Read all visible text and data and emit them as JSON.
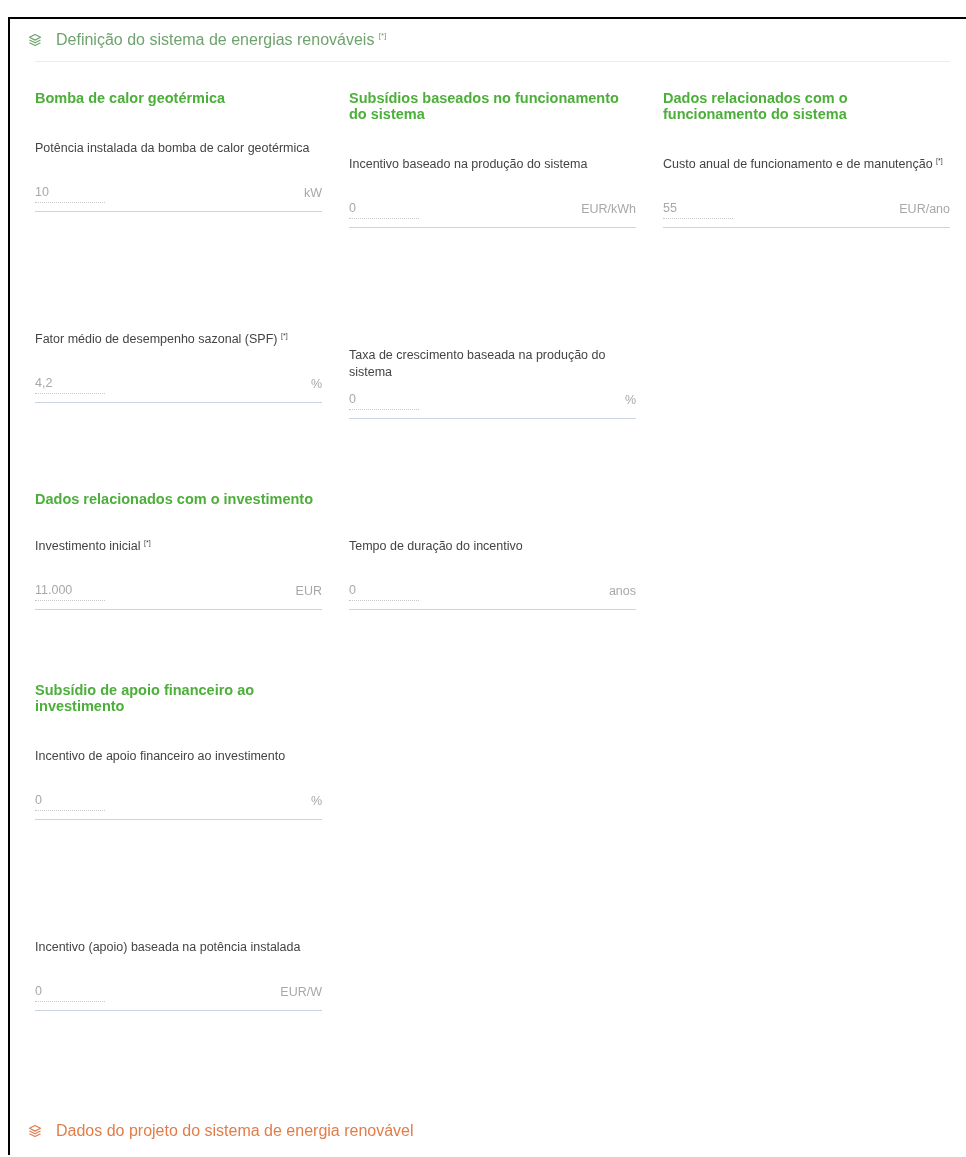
{
  "sections": [
    {
      "title": "Definição do sistema de energias renováveis $^{[*]}$",
      "expanded": true,
      "groups": [
        {
          "columns": [
            {
              "heading": "Bomba de calor geotérmica",
              "fields": [
                {
                  "label": "Potência instalada da bomba de calor geotérmica",
                  "value": "10",
                  "unit": "kW"
                },
                {
                  "label": "Fator médio de desempenho sazonal (SPF) $^{[*]}$",
                  "value": "4,2",
                  "unit": "%"
                }
              ]
            },
            {
              "heading": "Subsídios baseados no funcionamento do sistema",
              "fields": [
                {
                  "label": "Incentivo baseado na produção do sistema",
                  "value": "0",
                  "unit": "EUR/kWh"
                },
                {
                  "label": "Taxa de crescimento baseada na produção do sistema",
                  "value": "0",
                  "unit": "%"
                }
              ]
            },
            {
              "heading": "Dados relacionados com o funcionamento do sistema",
              "fields": [
                {
                  "label": "Custo anual de funcionamento e de manutenção $^{[*]}$",
                  "value": "55",
                  "unit": "EUR/ano"
                }
              ]
            }
          ]
        },
        {
          "heading": "Dados relacionados com o investimento",
          "columns": [
            {
              "fields": [
                {
                  "label": "Investimento inicial $^{[*]}$",
                  "value": "11.000",
                  "unit": "EUR"
                }
              ]
            },
            {
              "fields": [
                {
                  "label": "Tempo de duração do incentivo",
                  "value": "0",
                  "unit": "anos"
                }
              ]
            }
          ]
        },
        {
          "columns": [
            {
              "heading": "Subsídio de apoio financeiro ao investimento",
              "fields": [
                {
                  "label": "Incentivo de apoio financeiro ao investimento",
                  "value": "0",
                  "unit": "%"
                },
                {
                  "label": "Incentivo (apoio) baseada na potência instalada",
                  "value": "0",
                  "unit": "EUR/W"
                }
              ]
            }
          ]
        }
      ]
    },
    {
      "title": "Dados do projeto do sistema de energia renovável",
      "expanded": false
    }
  ]
}
